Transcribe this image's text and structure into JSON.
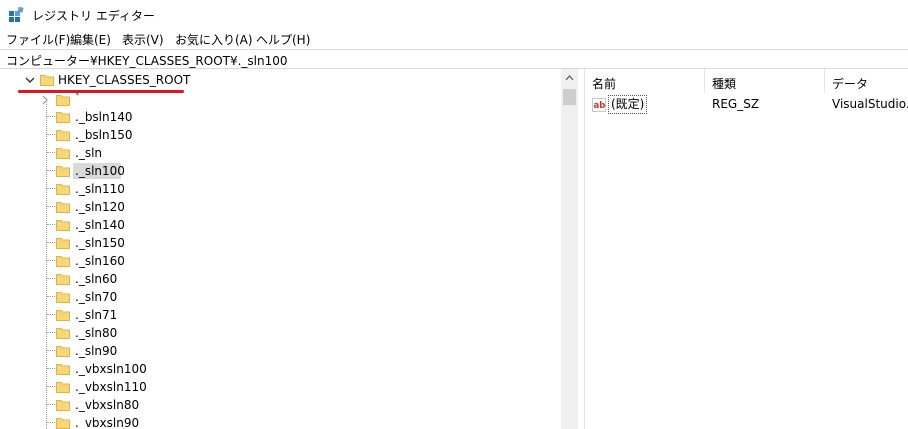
{
  "window": {
    "title": "レジストリ エディター",
    "icon": "registry-editor-icon"
  },
  "menu": [
    "ファイル(F)",
    "編集(E)",
    "表示(V)",
    "お気に入り(A)",
    "ヘルプ(H)"
  ],
  "address": "コンピューター¥HKEY_CLASSES_ROOT¥._sln100",
  "tree": {
    "root": "HKEY_CLASSES_ROOT",
    "partial_top": "*",
    "items": [
      "._bsln140",
      "._bsln150",
      "._sln",
      "._sln100",
      "._sln110",
      "._sln120",
      "._sln140",
      "._sln150",
      "._sln160",
      "._sln60",
      "._sln70",
      "._sln71",
      "._sln80",
      "._sln90",
      "._vbxsln100",
      "._vbxsln110",
      "._vbxsln80",
      "._vbxsln90"
    ],
    "selected": "._sln100",
    "colors": {
      "folder": "#f8d775",
      "folder_edge": "#dcb44a",
      "highlight": "#d9d9d9",
      "annotation": "#e0141e"
    }
  },
  "list": {
    "headers": {
      "name": "名前",
      "type": "種類",
      "data": "データ"
    },
    "rows": [
      {
        "icon": "string-value-icon",
        "name": "(既定)",
        "type": "REG_SZ",
        "data": "VisualStudio.L"
      }
    ]
  }
}
